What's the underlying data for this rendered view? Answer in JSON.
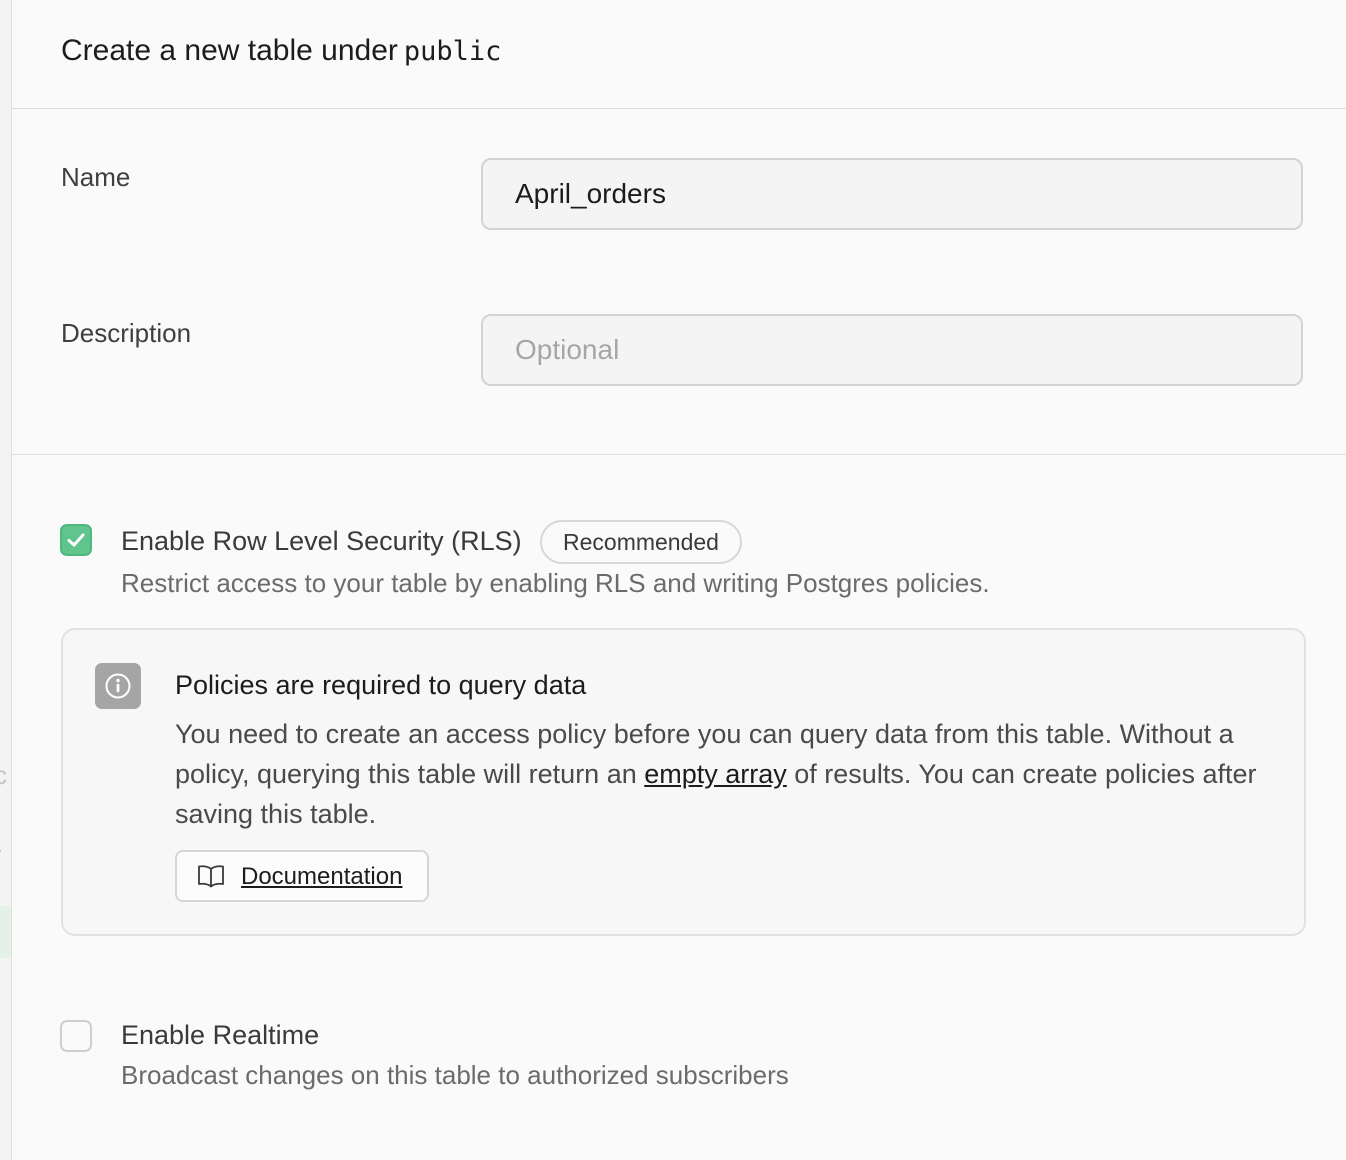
{
  "header": {
    "title": "Create a new table under",
    "schema": "public"
  },
  "form": {
    "name": {
      "label": "Name",
      "value": "April_orders"
    },
    "description": {
      "label": "Description",
      "placeholder": "Optional",
      "value": ""
    }
  },
  "rls": {
    "checked": true,
    "label": "Enable Row Level Security (RLS)",
    "badge": "Recommended",
    "description": "Restrict access to your table by enabling RLS and writing Postgres policies."
  },
  "alert": {
    "icon": "info-icon",
    "title": "Policies are required to query data",
    "body_before": "You need to create an access policy before you can query data from this table. Without a policy, querying this table will return an ",
    "body_link": "empty array",
    "body_after": " of results. You can create policies after saving this table.",
    "button_label": "Documentation",
    "button_icon": "book-icon"
  },
  "realtime": {
    "checked": false,
    "label": "Enable Realtime",
    "description": "Broadcast changes on this table to authorized subscribers"
  },
  "colors": {
    "accent": "#5fc58c",
    "text": "#1c1c1c",
    "muted": "#6b6b6b",
    "border": "#dedede"
  }
}
